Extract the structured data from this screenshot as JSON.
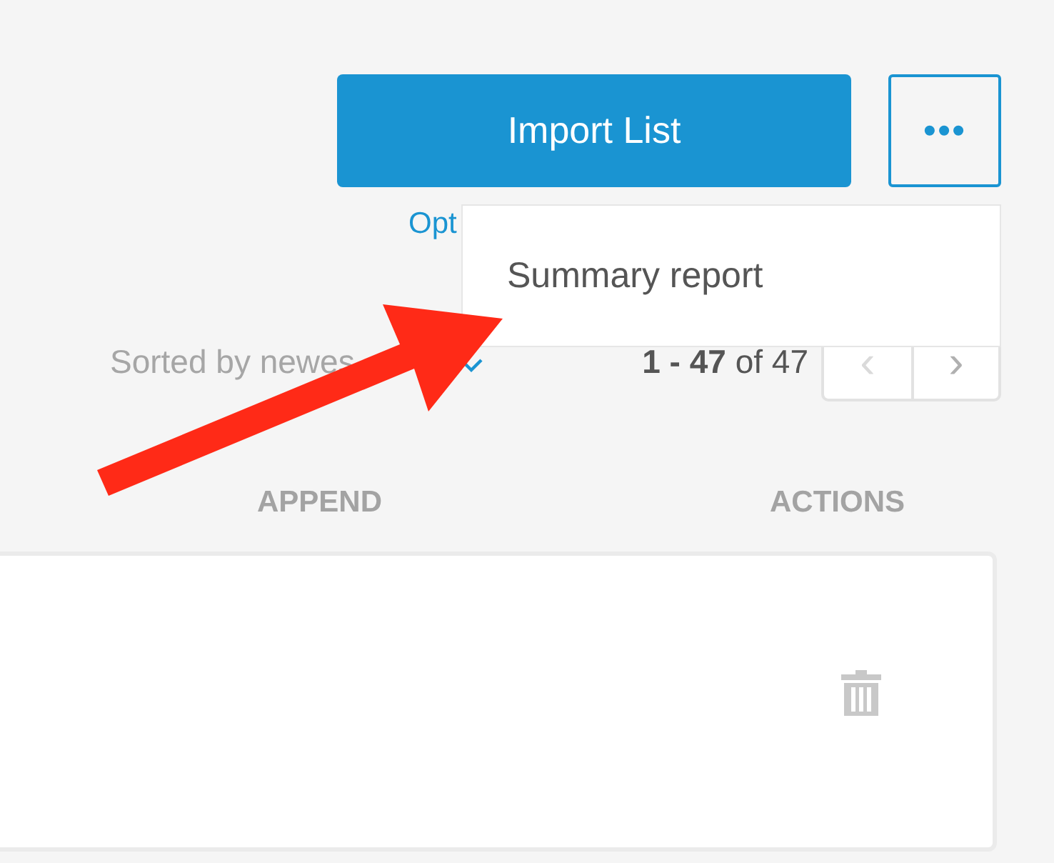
{
  "toolbar": {
    "import_button": "Import List",
    "more_button": "•••"
  },
  "options_link": "Opt",
  "menu": {
    "items": [
      {
        "label": "Summary report"
      }
    ]
  },
  "sort": {
    "label": "Sorted by newes"
  },
  "pagination": {
    "range": "**1 - 47** of 47",
    "buttons": [
      {
        "label": "‹",
        "disabled": true
      },
      {
        "label": "›",
        "disabled": false
      }
    ]
  },
  "table": {
    "columns": [
      "APPEND",
      "ACTIONS"
    ],
    "rows": [
      {
        "actions": [
          {
            "kind": "delete"
          }
        ]
      }
    ]
  },
  "annotation": {
    "kind": "arrow"
  }
}
